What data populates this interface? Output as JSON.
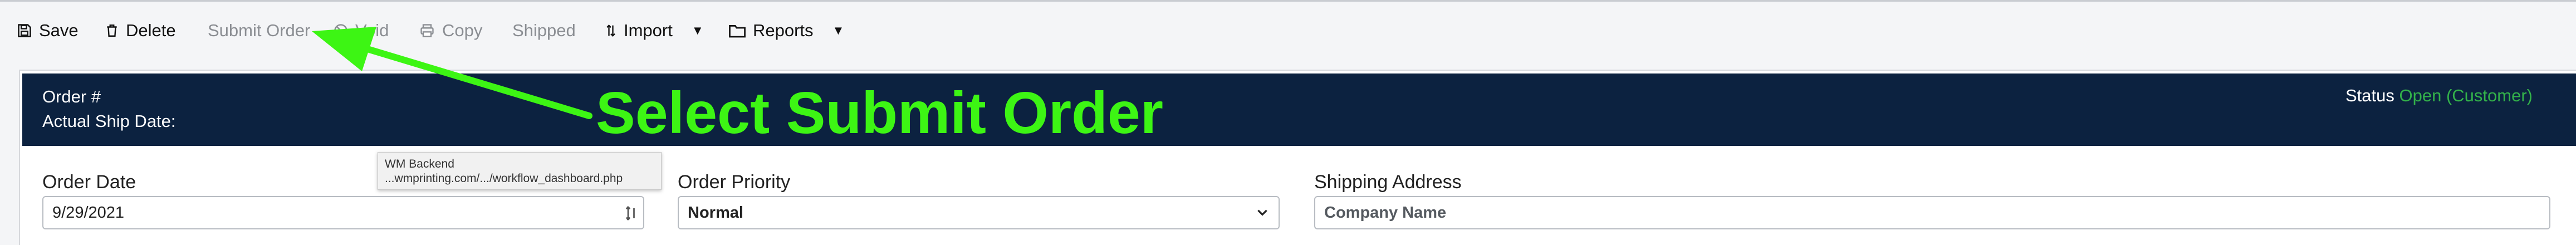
{
  "toolbar": {
    "save_label": "Save",
    "delete_label": "Delete",
    "submit_order_label": "Submit Order",
    "void_label": "Void",
    "copy_label": "Copy",
    "shipped_label": "Shipped",
    "import_label": "Import",
    "reports_label": "Reports"
  },
  "order_header": {
    "order_number_label": "Order #",
    "actual_ship_date_label": "Actual Ship Date:",
    "status_label": "Status",
    "status_value": "Open (Customer)"
  },
  "form": {
    "order_date_label": "Order Date",
    "order_date_value": "9/29/2021",
    "order_priority_label": "Order Priority",
    "order_priority_value": "Normal",
    "shipping_address_label": "Shipping Address",
    "company_name_placeholder": "Company Name"
  },
  "tooltip": {
    "title": "WM Backend",
    "url": "...wmprinting.com/.../workflow_dashboard.php"
  },
  "annotation": {
    "text": "Select Submit Order",
    "color": "#3df514"
  },
  "colors": {
    "header_bg": "#0c2240",
    "status_green": "#33b24a",
    "page_bg": "#f4f5f7"
  }
}
